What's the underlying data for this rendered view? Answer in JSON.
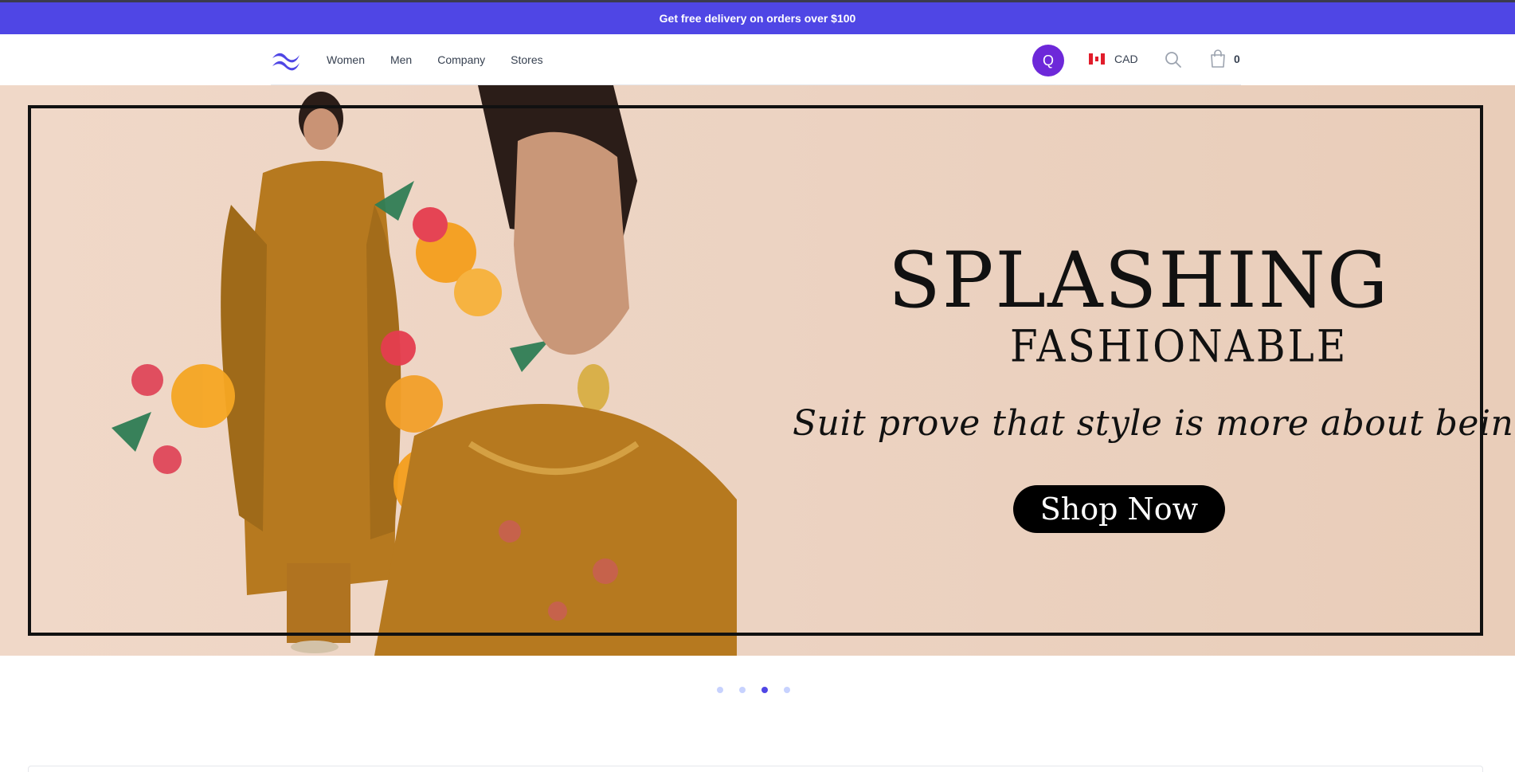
{
  "promo": {
    "text": "Get free delivery on orders over $100"
  },
  "nav": {
    "links": [
      "Women",
      "Men",
      "Company",
      "Stores"
    ],
    "profile_initial": "Q",
    "currency": "CAD",
    "cart_count": "0"
  },
  "hero": {
    "headline_1": "SPLASHING",
    "headline_2": "FASHIONABLE",
    "tagline": "Suit prove that style is more about being yourself.",
    "cta_label": "Shop Now"
  },
  "carousel": {
    "total_slides": 4,
    "active_index": 2
  },
  "colors": {
    "promo_bg": "#4f46e5",
    "profile_bg": "#6d28d9",
    "cta_bg": "#000000",
    "dot_active": "#4f46e5",
    "dot_inactive": "#c7d2fe"
  },
  "icons": [
    "tailwind-logo-icon",
    "canada-flag-icon",
    "search-icon",
    "shopping-bag-icon"
  ]
}
